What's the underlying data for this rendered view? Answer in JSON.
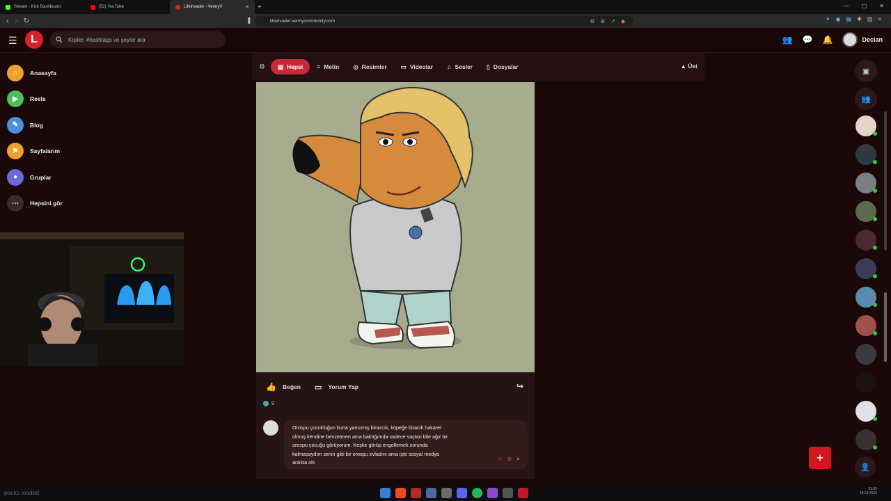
{
  "browser": {
    "tabs": [
      {
        "label": "Stream - Kick Dashboard",
        "color": "#53fc18"
      },
      {
        "label": "(52) YouTube",
        "color": "#ff0000"
      },
      {
        "label": "Lifeinvader - VennyV",
        "color": "#d8222a"
      }
    ],
    "url": "lifeinvader.vennycommunity.com"
  },
  "header": {
    "logo_letter": "L",
    "search_placeholder": "Kişiler, #hashtags ve şeyler ara",
    "username": "Declan"
  },
  "sidebar": {
    "items": [
      {
        "label": "Anasayfa",
        "icon": "home-icon",
        "color": "#f0a02c"
      },
      {
        "label": "Reels",
        "icon": "reels-icon",
        "color": "#4cbf5a"
      },
      {
        "label": "Blog",
        "icon": "blog-icon",
        "color": "#4a8fe0"
      },
      {
        "label": "Sayfalarım",
        "icon": "flag-icon",
        "color": "#f0a02c"
      },
      {
        "label": "Gruplar",
        "icon": "groups-icon",
        "color": "#6a6ad8"
      },
      {
        "label": "Hepsini gör",
        "icon": "more-icon",
        "color": "#444444"
      }
    ]
  },
  "filters": {
    "items": [
      {
        "label": "Hepsi",
        "icon": "all-icon",
        "active": true
      },
      {
        "label": "Metin",
        "icon": "text-icon",
        "active": false
      },
      {
        "label": "Resimler",
        "icon": "camera-icon",
        "active": false
      },
      {
        "label": "Videolar",
        "icon": "video-icon",
        "active": false
      },
      {
        "label": "Sesler",
        "icon": "music-icon",
        "active": false
      },
      {
        "label": "Dosyalar",
        "icon": "file-icon",
        "active": false
      }
    ],
    "up_label": "Üst"
  },
  "post": {
    "like_label": "Beğen",
    "comment_label": "Yorum Yap",
    "like_count": "9",
    "comment_lines": [
      "Orospu çocukluğun buna yansımış birazcık, köpeğe biracık hakaret",
      "olmuş kendine benzetmen ama baktığımda sadece saçtan bile ağır bir",
      "orospu çocuğu görüyorum. Keşke görüp engellemek zorunda",
      "kalmasaydım senin gibi bir orospu evladını ama işte sosyal medya",
      "anlıkta ols"
    ]
  },
  "taskbar": {
    "message": "packs loaded",
    "time": "21:53",
    "date": "18.03.2026"
  },
  "colors": {
    "accent": "#c62a3a",
    "fab": "#d0181e",
    "background": "#1b0909"
  }
}
